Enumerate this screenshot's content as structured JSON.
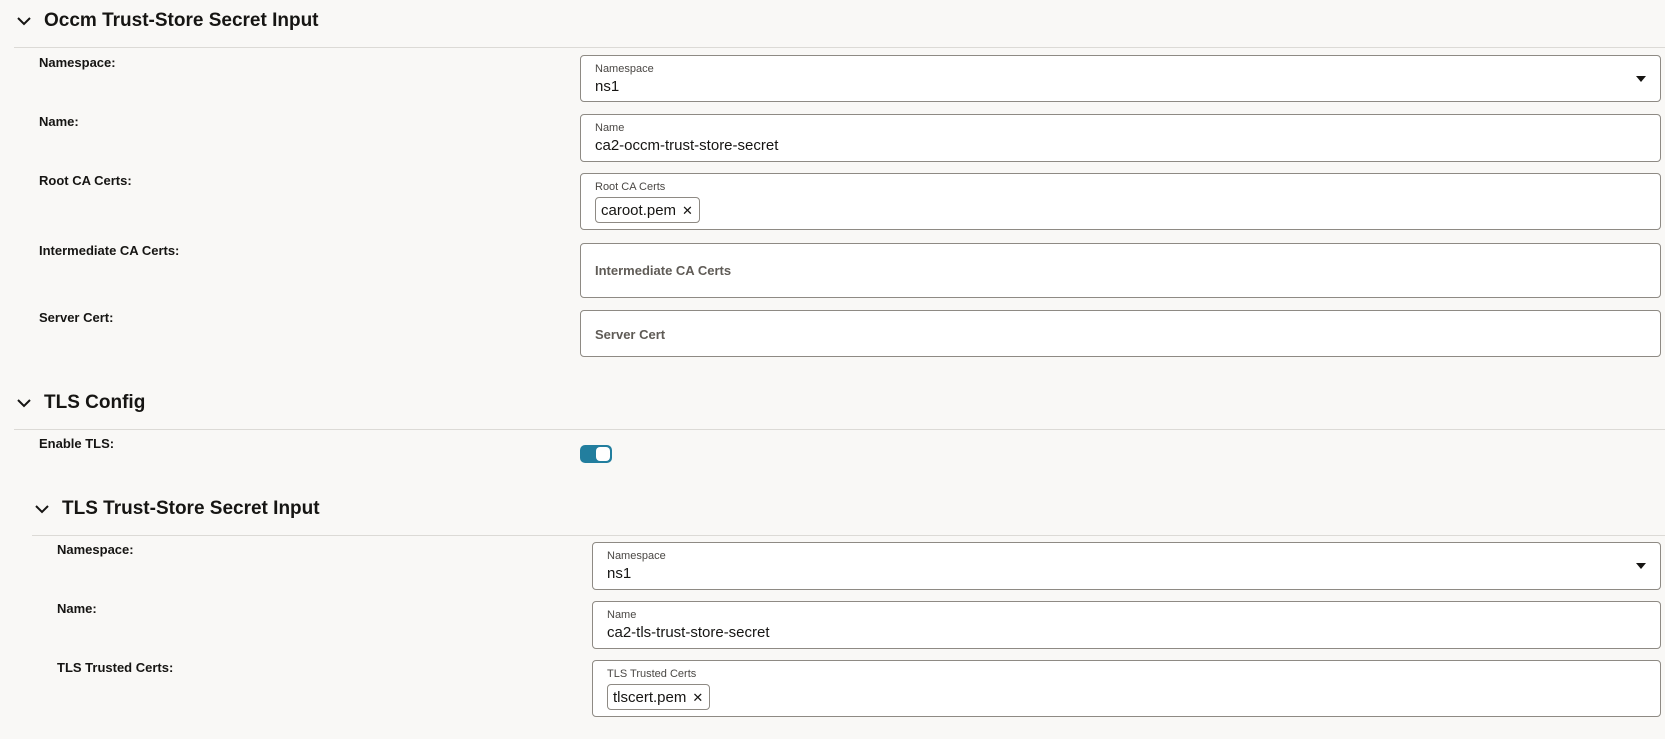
{
  "occm": {
    "title": "Occm Trust-Store Secret Input",
    "namespace": {
      "row_label": "Namespace:",
      "field_label": "Namespace",
      "value": "ns1"
    },
    "name": {
      "row_label": "Name:",
      "field_label": "Name",
      "value": "ca2-occm-trust-store-secret"
    },
    "root_ca": {
      "row_label": "Root CA Certs:",
      "field_label": "Root CA Certs",
      "chips": [
        "caroot.pem"
      ]
    },
    "intermediate_ca": {
      "row_label": "Intermediate CA Certs:",
      "placeholder": "Intermediate CA Certs"
    },
    "server_cert": {
      "row_label": "Server Cert:",
      "placeholder": "Server Cert"
    }
  },
  "tls_config": {
    "title": "TLS Config",
    "enable_tls": {
      "row_label": "Enable TLS:",
      "on": true
    }
  },
  "tls_trust_store": {
    "title": "TLS Trust-Store Secret Input",
    "namespace": {
      "row_label": "Namespace:",
      "field_label": "Namespace",
      "value": "ns1"
    },
    "name": {
      "row_label": "Name:",
      "field_label": "Name",
      "value": "ca2-tls-trust-store-secret"
    },
    "trusted_certs": {
      "row_label": "TLS Trusted Certs:",
      "field_label": "TLS Trusted Certs",
      "chips": [
        "tlscert.pem"
      ]
    }
  },
  "icons": {
    "section_toggle": "chevron-down-icon",
    "dropdown": "caret-down-icon",
    "chip_remove": "close-icon"
  },
  "colors": {
    "accent": "#227e9e",
    "background": "#f9f8f6",
    "border": "#8e8a84"
  }
}
